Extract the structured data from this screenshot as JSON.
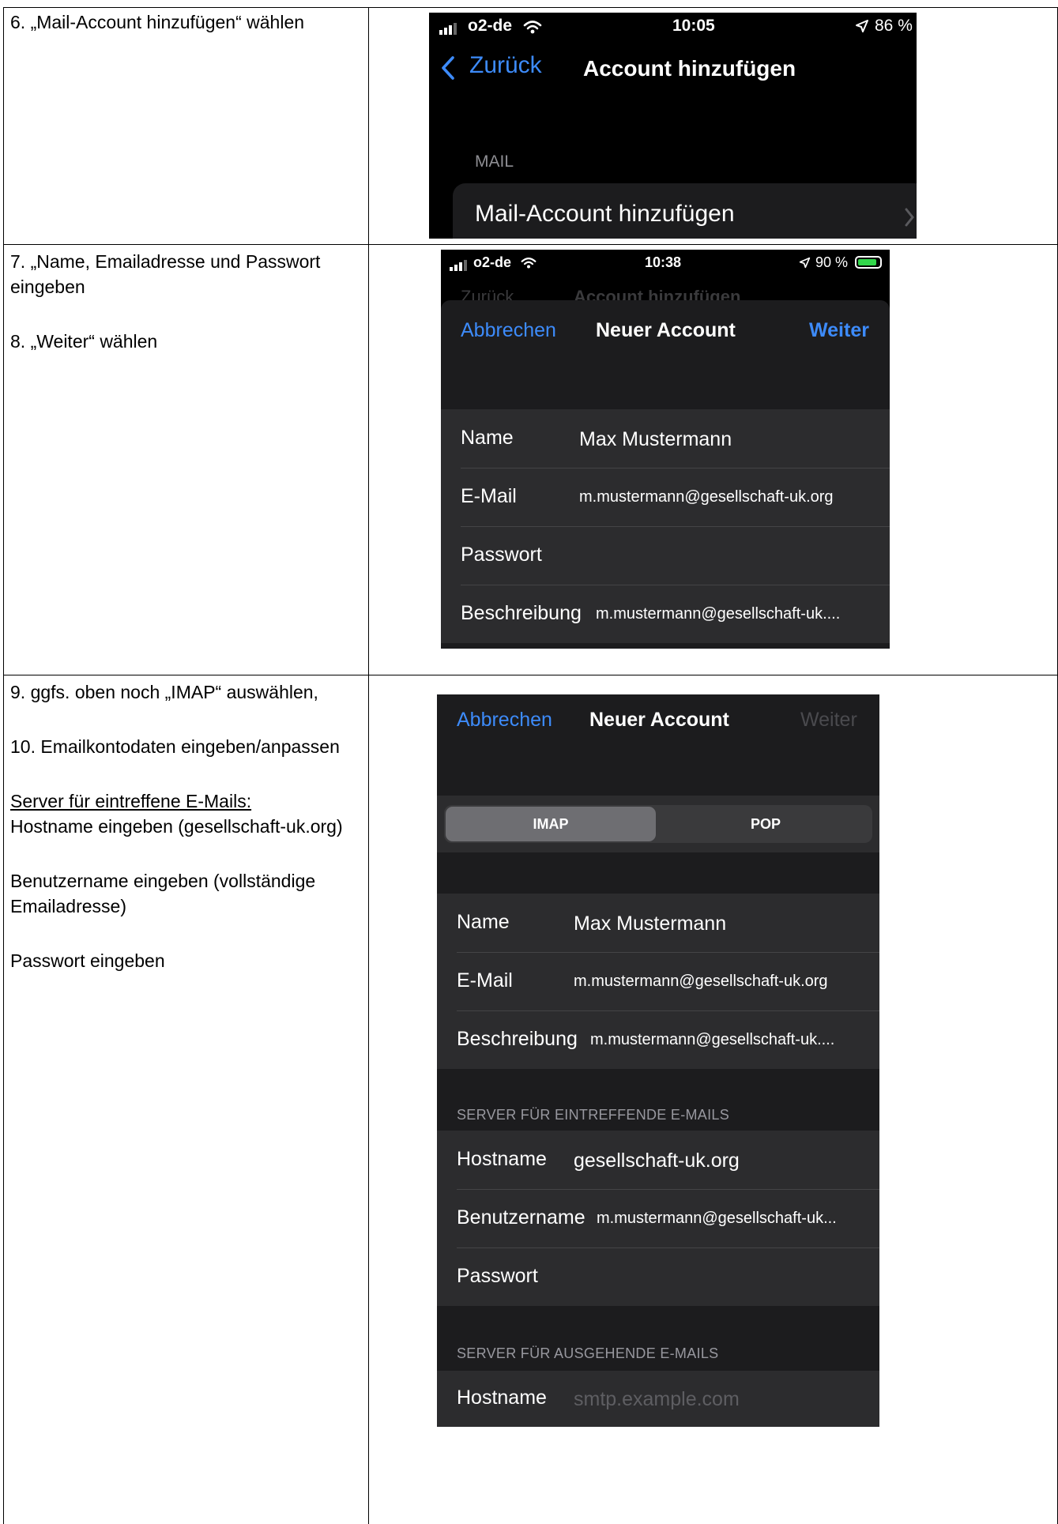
{
  "steps": {
    "s6": {
      "line1": "6. „Mail-Account hinzufügen“ wählen"
    },
    "s7": {
      "line1": "7. „Name, Emailadresse und Passwort",
      "line2": "eingeben",
      "line3": "8. „Weiter“ wählen"
    },
    "s9": {
      "line1": "9. ggfs. oben noch „IMAP“ auswählen,",
      "line2": "10. Emailkontodaten eingeben/anpassen",
      "line3": "Server für eintreffene E-Mails:",
      "line4": "Hostname eingeben (gesellschaft-uk.org)",
      "line5": "Benutzername eingeben (vollständige",
      "line6": "Emailadresse)",
      "line7": "Passwort eingeben"
    }
  },
  "screen1": {
    "carrier": "o2-de",
    "time": "10:05",
    "battery": "86 %",
    "back_label": "Zurück",
    "title": "Account hinzufügen",
    "section": "MAIL",
    "item": "Mail-Account hinzufügen"
  },
  "screen2": {
    "carrier": "o2-de",
    "time": "10:38",
    "battery": "90 %",
    "bg_back": "Zurück",
    "bg_title": "Account hinzufügen",
    "cancel": "Abbrechen",
    "title": "Neuer Account",
    "next": "Weiter",
    "fields": [
      {
        "label": "Name",
        "value": "Max Mustermann"
      },
      {
        "label": "E-Mail",
        "value": "m.mustermann@gesellschaft-uk.org"
      },
      {
        "label": "Passwort",
        "value": ""
      },
      {
        "label": "Beschreibung",
        "value": "m.mustermann@gesellschaft-uk...."
      }
    ]
  },
  "screen3": {
    "cancel": "Abbrechen",
    "title": "Neuer Account",
    "next": "Weiter",
    "segments": [
      "IMAP",
      "POP"
    ],
    "selected_segment": "IMAP",
    "fields": [
      {
        "label": "Name",
        "value": "Max Mustermann"
      },
      {
        "label": "E-Mail",
        "value": "m.mustermann@gesellschaft-uk.org"
      },
      {
        "label": "Beschreibung",
        "value": "m.mustermann@gesellschaft-uk...."
      }
    ],
    "incoming": {
      "title": "SERVER FÜR EINTREFFENDE E-MAILS",
      "fields": [
        {
          "label": "Hostname",
          "value": "gesellschaft-uk.org"
        },
        {
          "label": "Benutzername",
          "value": "m.mustermann@gesellschaft-uk..."
        },
        {
          "label": "Passwort",
          "value": ""
        }
      ]
    },
    "outgoing": {
      "title": "SERVER FÜR AUSGEHENDE E-MAILS",
      "fields": [
        {
          "label": "Hostname",
          "placeholder": "smtp.example.com"
        }
      ]
    }
  },
  "colors": {
    "accent": "#3d8bfa",
    "sheet": "#1c1c1e",
    "row": "#2c2c2e",
    "battery_charging": "#32d74b"
  },
  "icons": [
    "signal-icon",
    "wifi-icon",
    "location-arrow-icon",
    "battery-icon",
    "chevron-left-icon",
    "chevron-right-icon"
  ]
}
